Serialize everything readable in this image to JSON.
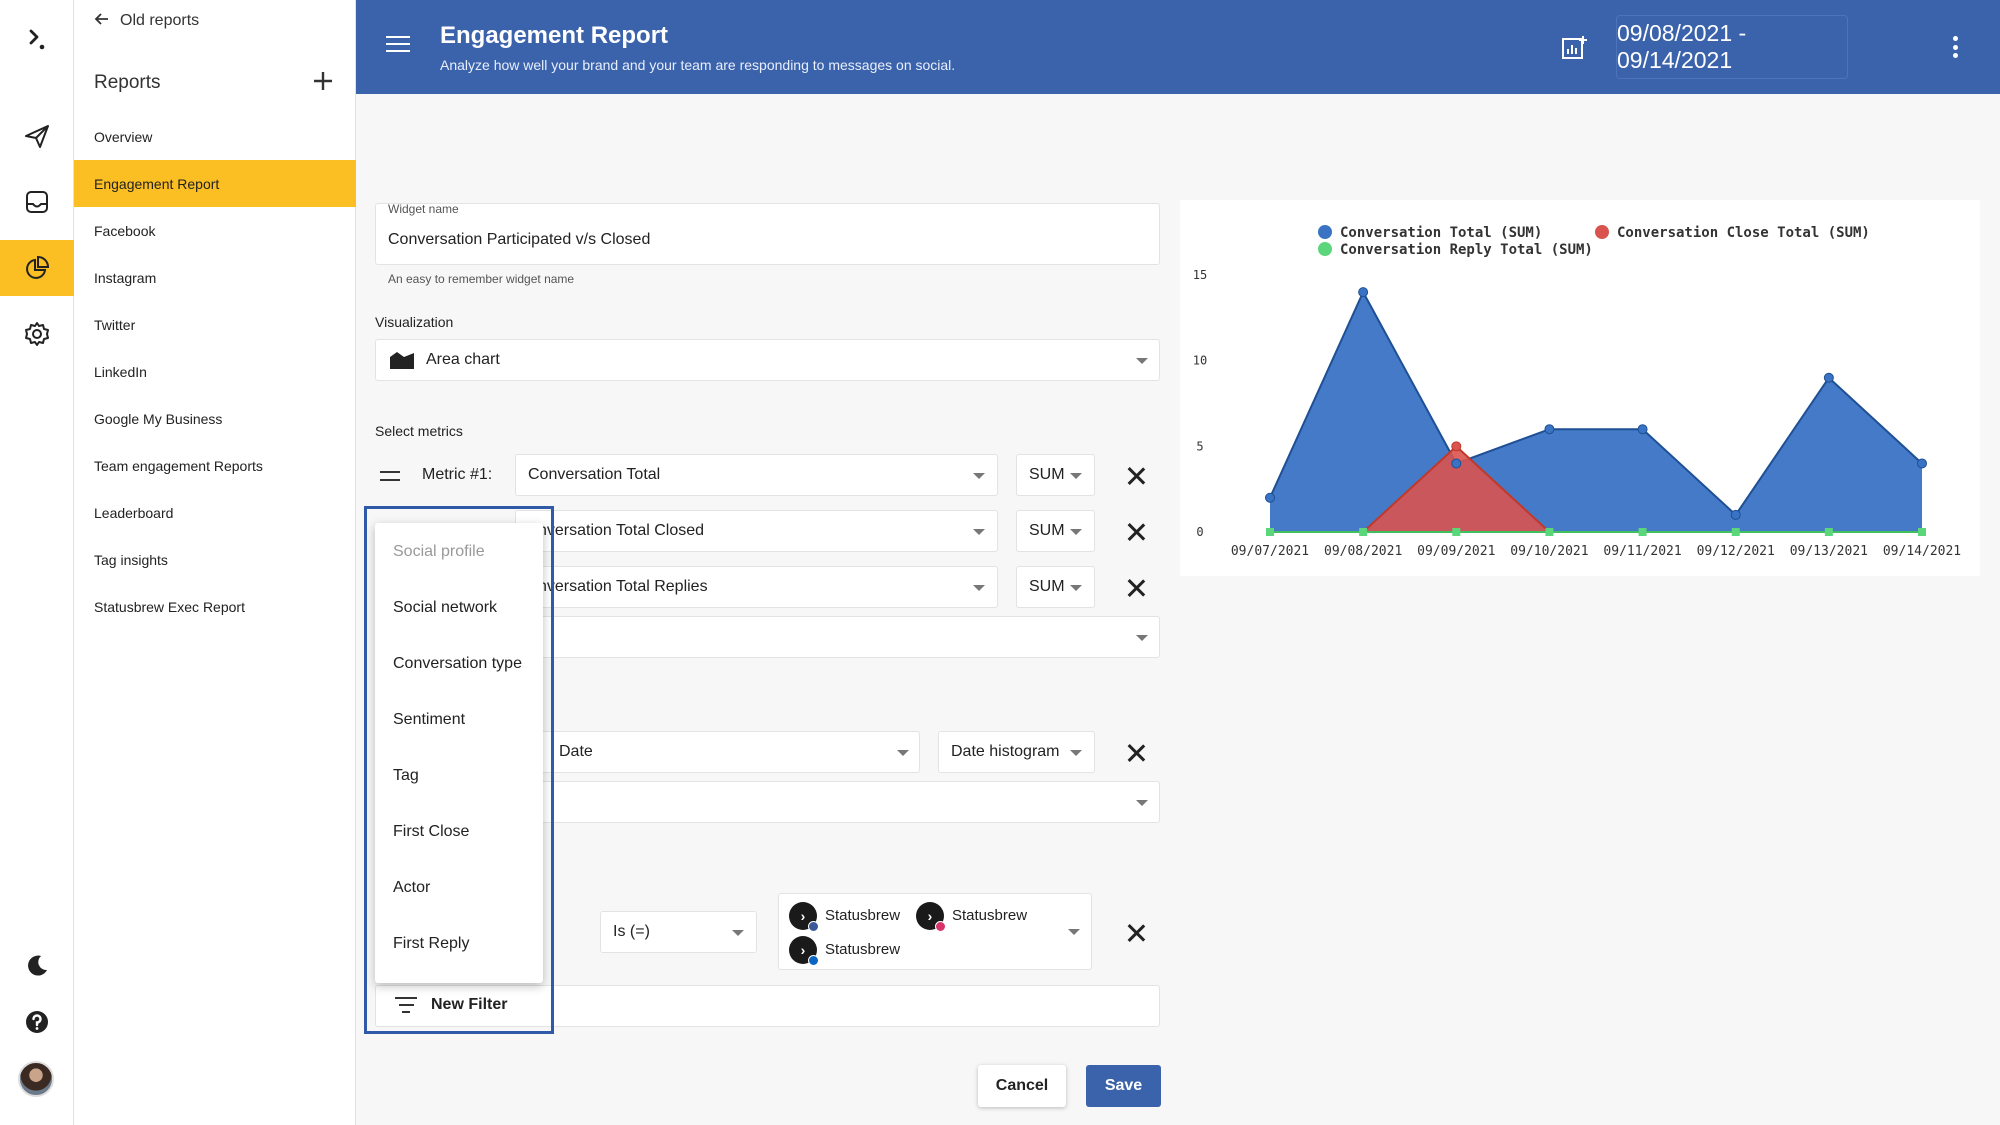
{
  "rail": {
    "items": [
      {
        "icon": "logo-icon",
        "active": false
      },
      {
        "icon": "paper-plane-icon",
        "active": false
      },
      {
        "icon": "inbox-icon",
        "active": false
      },
      {
        "icon": "pie-chart-icon",
        "active": true
      },
      {
        "icon": "gear-icon",
        "active": false
      }
    ],
    "bottom": [
      "moon-icon",
      "help-icon",
      "avatar"
    ]
  },
  "sidebar": {
    "back_label": "Old reports",
    "title": "Reports",
    "items": [
      {
        "label": "Overview",
        "active": false
      },
      {
        "label": "Engagement Report",
        "active": true
      },
      {
        "label": "Facebook",
        "active": false
      },
      {
        "label": "Instagram",
        "active": false
      },
      {
        "label": "Twitter",
        "active": false
      },
      {
        "label": "LinkedIn",
        "active": false
      },
      {
        "label": "Google My Business",
        "active": false
      },
      {
        "label": "Team engagement Reports",
        "active": false
      },
      {
        "label": "Leaderboard",
        "active": false
      },
      {
        "label": "Tag insights",
        "active": false
      },
      {
        "label": "Statusbrew Exec Report",
        "active": false
      }
    ]
  },
  "header": {
    "title": "Engagement Report",
    "subtitle": "Analyze how well your brand and your team are responding to messages on social.",
    "date_range": "09/08/2021 - 09/14/2021"
  },
  "form": {
    "widget_name_label": "Widget name",
    "widget_name_value": "Conversation Participated v/s Closed",
    "widget_name_hint": "An easy to remember widget name",
    "visualization_label": "Visualization",
    "visualization_value": "Area chart",
    "metrics_label": "Select metrics",
    "metric1_label": "Metric #1:",
    "metrics": [
      {
        "value": "Conversation Total",
        "agg": "SUM"
      },
      {
        "value": "nversation Total Closed",
        "agg": "SUM"
      },
      {
        "value": "nversation Total Replies",
        "agg": "SUM"
      }
    ],
    "group_by_value": "Date",
    "group_by_agg": "Date histogram",
    "filter_operator": "Is (=)",
    "filter_profiles": [
      {
        "name": "Statusbrew",
        "network": "facebook"
      },
      {
        "name": "Statusbrew",
        "network": "instagram"
      },
      {
        "name": "Statusbrew",
        "network": "linkedin"
      }
    ],
    "cancel_label": "Cancel",
    "save_label": "Save"
  },
  "dropdown": {
    "items": [
      {
        "label": "Social profile",
        "disabled": true
      },
      {
        "label": "Social network",
        "disabled": false
      },
      {
        "label": "Conversation type",
        "disabled": false
      },
      {
        "label": "Sentiment",
        "disabled": false
      },
      {
        "label": "Tag",
        "disabled": false
      },
      {
        "label": "First Close",
        "disabled": false
      },
      {
        "label": "Actor",
        "disabled": false
      },
      {
        "label": "First Reply",
        "disabled": false
      }
    ],
    "new_filter_label": "New Filter"
  },
  "chart_data": {
    "type": "area",
    "x": [
      "09/07/2021",
      "09/08/2021",
      "09/09/2021",
      "09/10/2021",
      "09/11/2021",
      "09/12/2021",
      "09/13/2021",
      "09/14/2021"
    ],
    "ylim": [
      0,
      15
    ],
    "yticks": [
      0,
      5,
      10,
      15
    ],
    "legend_position": "top",
    "series": [
      {
        "name": "Conversation Total (SUM)",
        "color": "#3a73c4",
        "values": [
          2,
          14,
          4,
          6,
          6,
          1,
          9,
          4
        ]
      },
      {
        "name": "Conversation Close Total (SUM)",
        "color": "#d9534f",
        "values": [
          0,
          0,
          5,
          0,
          0,
          0,
          0,
          0
        ]
      },
      {
        "name": "Conversation Reply Total (SUM)",
        "color": "#5cd67a",
        "values": [
          0,
          0,
          0,
          0,
          0,
          0,
          0,
          0
        ]
      }
    ]
  }
}
